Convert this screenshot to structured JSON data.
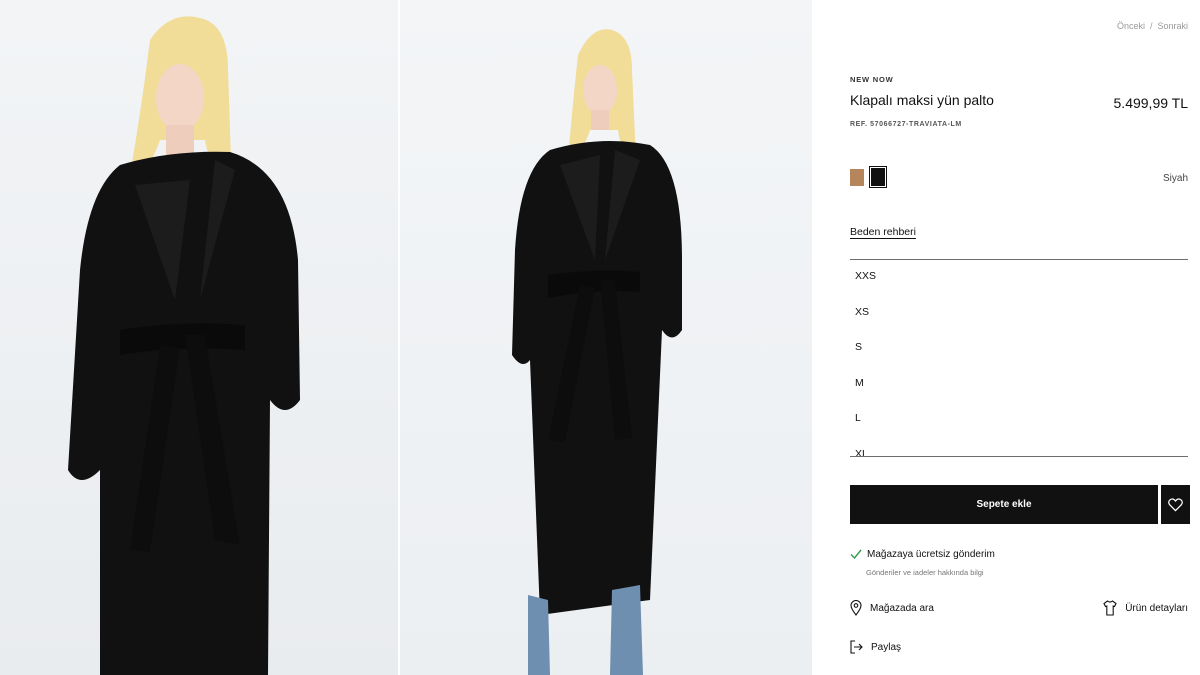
{
  "nav": {
    "prev_label": "Önceki",
    "separator": "/",
    "next_label": "Sonraki"
  },
  "product": {
    "tag": "NEW NOW",
    "title": "Klapalı maksi yün palto",
    "price": "5.499,99 TL",
    "ref": "REF. 57066727-TRAVIATA-LM",
    "colors": [
      {
        "name": "camel",
        "hex": "#b5855b"
      },
      {
        "name": "Siyah",
        "hex": "#111111",
        "selected": true
      }
    ],
    "selected_color_name": "Siyah"
  },
  "sizes": {
    "guide_label": "Beden rehberi",
    "items": [
      "XXS",
      "XS",
      "S",
      "M",
      "L",
      "XL"
    ]
  },
  "cart": {
    "add_label": "Sepete ekle",
    "favorite_icon": "heart-icon"
  },
  "shipping": {
    "title": "Mağazaya ücretsiz gönderim",
    "subtitle": "Gönderiler ve iadeler hakkında bilgi",
    "check_icon": "check-icon",
    "check_color": "#2e9b4a"
  },
  "actions": {
    "find_in_store": "Mağazada ara",
    "product_details": "Ürün detayları",
    "share": "Paylaş"
  },
  "colors": {
    "primary": "#111111",
    "background": "#ffffff",
    "muted": "#9a9a9a"
  }
}
